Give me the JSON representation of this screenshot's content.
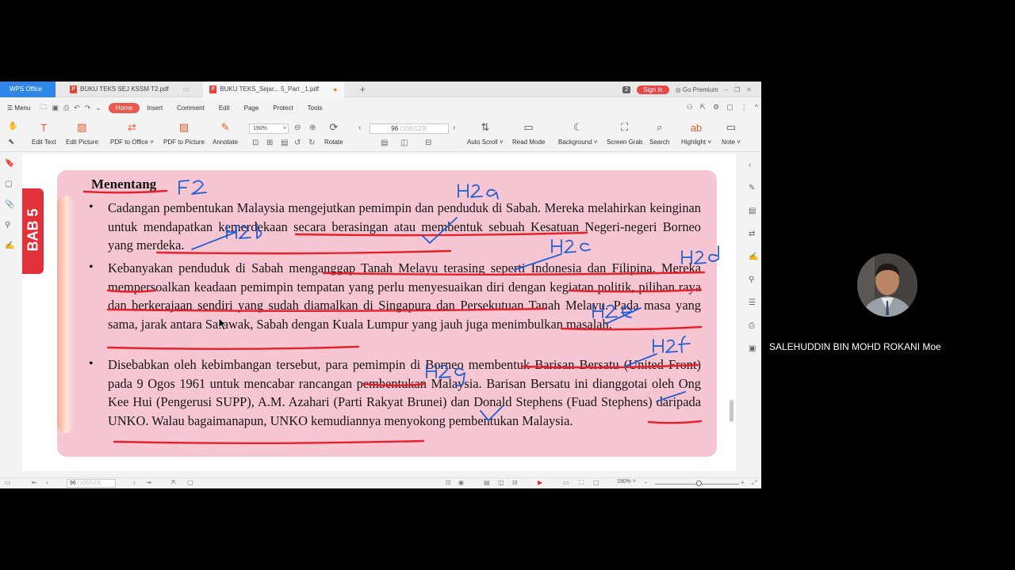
{
  "tabs": {
    "home": "WPS Office",
    "doc1": "BUKU TEKS SEJ KSSM T2.pdf",
    "doc2": "BUKU TEKS_Sejar... 5_Part _1.pdf",
    "pdf_badge": "P",
    "count": "2",
    "signin": "Sign in",
    "premium": "Go Premium"
  },
  "menu": {
    "menu": "Menu",
    "items": [
      "Home",
      "Insert",
      "Comment",
      "Edit",
      "Page",
      "Protect",
      "Tools"
    ]
  },
  "toolbar": {
    "edit_text": "Edit Text",
    "edit_picture": "Edit Picture",
    "pdf_to_office": "PDF to Office",
    "pdf_to_picture": "PDF to Picture",
    "annotate": "Annotate",
    "zoom": "190%",
    "rotate": "Rotate",
    "page_current": "96",
    "page_sub": "(106/123)",
    "auto_scroll": "Auto Scroll",
    "read_mode": "Read Mode",
    "background": "Background",
    "screen_grab": "Screen Grab",
    "search": "Search",
    "highlight": "Highlight",
    "note": "Note"
  },
  "document": {
    "side_tab": "BAB 5",
    "heading": "Menentang",
    "bullet": "•",
    "paragraphs": [
      "Cadangan pembentukan Malaysia mengejutkan pemimpin dan penduduk di Sabah. Mereka melahirkan keinginan untuk mendapatkan kemerdekaan secara berasingan atau membentuk sebuah Kesatuan Negeri-negeri Borneo yang merdeka.",
      "Kebanyakan penduduk di Sabah menganggap Tanah Melayu terasing seperti Indonesia dan Filipina. Mereka mempersoalkan keadaan pemimpin tempatan yang perlu menyesuaikan diri dengan kegiatan politik, pilihan raya dan berkerajaan sendiri yang sudah diamalkan di Singapura dan Persekutuan Tanah Melayu. Pada masa yang sama, jarak antara Sarawak, Sabah dengan Kuala Lumpur yang jauh juga menimbulkan masalah.",
      "Disebabkan oleh kebimbangan tersebut, para pemimpin di Borneo membentuk Barisan Bersatu (United Front) pada 9 Ogos 1961 untuk mencabar rancangan pembentukan Malaysia. Barisan Bersatu ini dianggotai oleh Ong Kee Hui (Pengerusi SUPP), A.M. Azahari (Parti Rakyat Brunei) dan Donald Stephens (Fuad Stephens) daripada UNKO. Walau bagaimanapun, UNKO kemudiannya menyokong pembentukan Malaysia."
    ],
    "annotations": [
      "F2",
      "H2a",
      "H2b",
      "H2c",
      "H2d",
      "H2e",
      "H2f",
      "H2g"
    ]
  },
  "statusbar": {
    "page_current": "96",
    "page_sub": "(106/123)",
    "zoom": "190%"
  },
  "participant": {
    "name": "SALEHUDDIN BIN MOHD ROKANI Moe"
  },
  "colors": {
    "accent": "#2f86e8",
    "card": "#f6c7d3",
    "underline": "#e8202a",
    "ink": "#1f5fd6"
  }
}
